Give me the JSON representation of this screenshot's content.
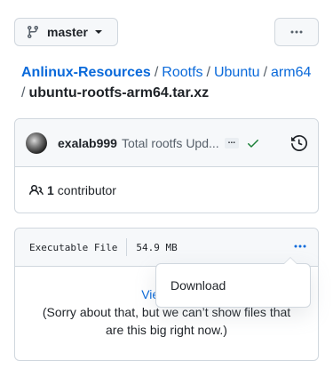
{
  "branch": {
    "label": "master",
    "icon": "git-branch-icon"
  },
  "more_button": {
    "icon": "kebab-horizontal-icon"
  },
  "breadcrumb": {
    "repo": "Anlinux-Resources",
    "dirs": [
      "Rootfs",
      "Ubuntu",
      "arm64"
    ],
    "separator": "/",
    "file": "ubuntu-rootfs-arm64.tar.xz"
  },
  "commit": {
    "author": "exalab999",
    "message": "Total rootfs Upd...",
    "expand_label": "...",
    "status": "success",
    "status_color": "#1a7f37",
    "history_icon": "history-icon"
  },
  "contributors": {
    "count": "1",
    "label": "contributor",
    "icon": "people-icon"
  },
  "file": {
    "mode": "Executable File",
    "size": "54.9 MB",
    "view_raw": "View raw",
    "message": "(Sorry about that, but we can’t show files that are this big right now.)"
  },
  "dropdown": {
    "items": [
      "Download"
    ]
  },
  "colors": {
    "link": "#0969da",
    "border": "#d0d7de",
    "header_bg": "#f6f8fa"
  }
}
